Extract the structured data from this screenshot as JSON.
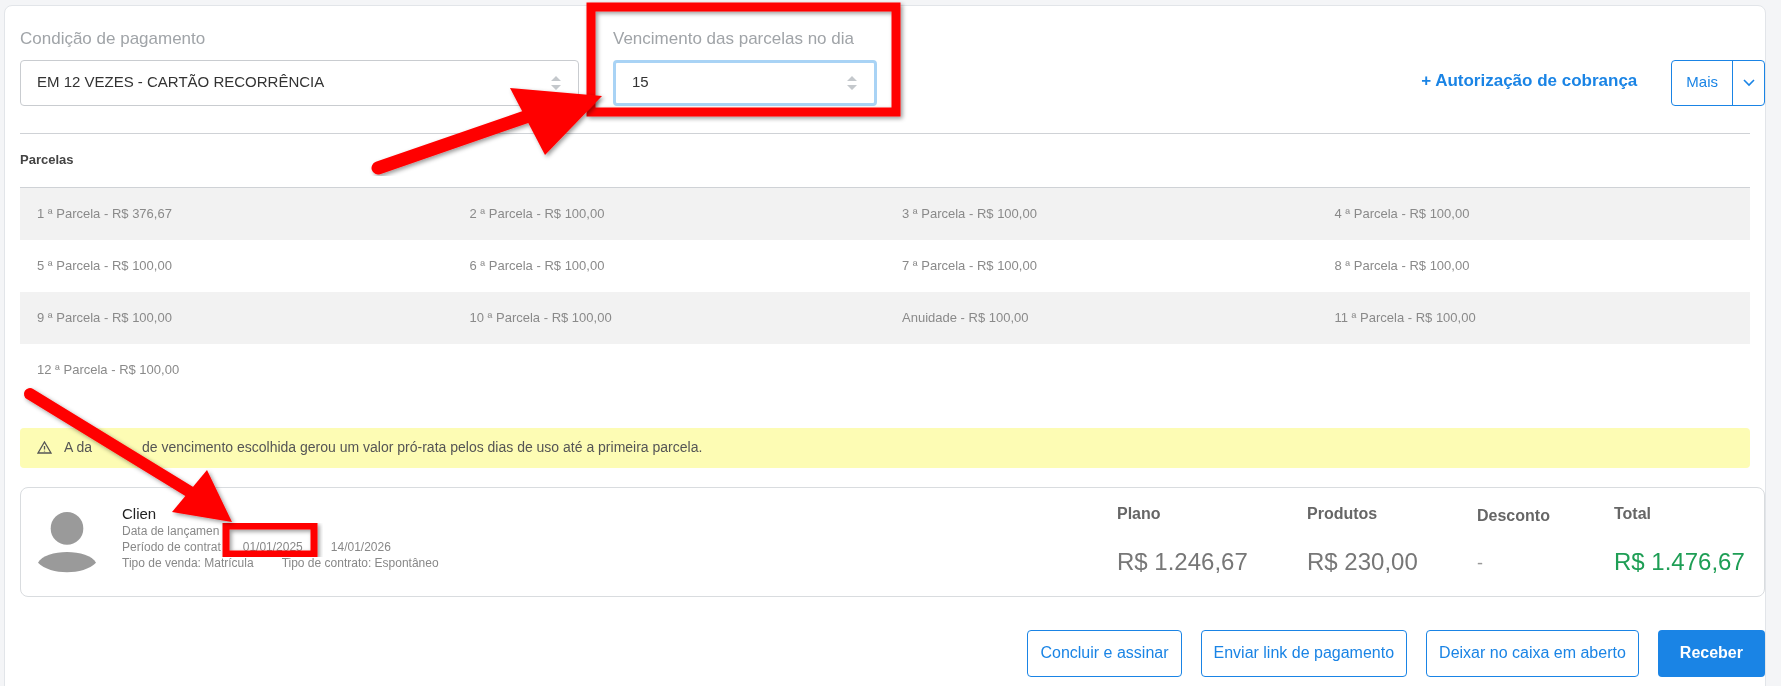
{
  "payment_condition": {
    "label": "Condição de pagamento",
    "value": "EM 12 VEZES - CARTÃO RECORRÊNCIA",
    "focused": false
  },
  "due_day": {
    "label": "Vencimento das parcelas no dia",
    "value": "15",
    "focused": true
  },
  "billing_authorization_link": "+ Autorização de cobrança",
  "more_button": "Mais",
  "installments": {
    "title": "Parcelas",
    "items": [
      "1 ª Parcela - R$ 376,67",
      "2 ª Parcela - R$ 100,00",
      "3 ª Parcela - R$ 100,00",
      "4 ª Parcela - R$ 100,00",
      "5 ª Parcela - R$ 100,00",
      "6 ª Parcela - R$ 100,00",
      "7 ª Parcela - R$ 100,00",
      "8 ª Parcela - R$ 100,00",
      "9 ª Parcela - R$ 100,00",
      "10 ª Parcela - R$ 100,00",
      "Anuidade - R$ 100,00",
      "11 ª Parcela - R$ 100,00",
      "12 ª Parcela - R$ 100,00"
    ]
  },
  "warning": [
    "A da",
    "de vencimento escolhida gerou um valor pró-rata pelos dias de uso até a primeira parcela."
  ],
  "summary": {
    "client": "Clien",
    "details": [
      [
        "Data de lançamen"
      ],
      [
        "Período de contrat",
        "01/01/2025",
        "14/01/2026"
      ],
      [
        "Tipo de venda: Matrícula",
        "Tipo de contrato: Espontâneo"
      ]
    ],
    "totals": [
      {
        "label": "Plano",
        "value": "R$ 1.246,67",
        "kind": "normal"
      },
      {
        "label": "Produtos",
        "value": "R$ 230,00",
        "kind": "normal"
      },
      {
        "label": "Desconto",
        "value": "-",
        "kind": "small"
      },
      {
        "label": "Total",
        "value": "R$ 1.476,67",
        "kind": "total"
      }
    ]
  },
  "actions": [
    {
      "label": "Concluir e assinar",
      "kind": "outline"
    },
    {
      "label": "Enviar link de pagamento",
      "kind": "outline"
    },
    {
      "label": "Deixar no caixa em aberto",
      "kind": "outline"
    },
    {
      "label": "Receber",
      "kind": "primary"
    }
  ]
}
